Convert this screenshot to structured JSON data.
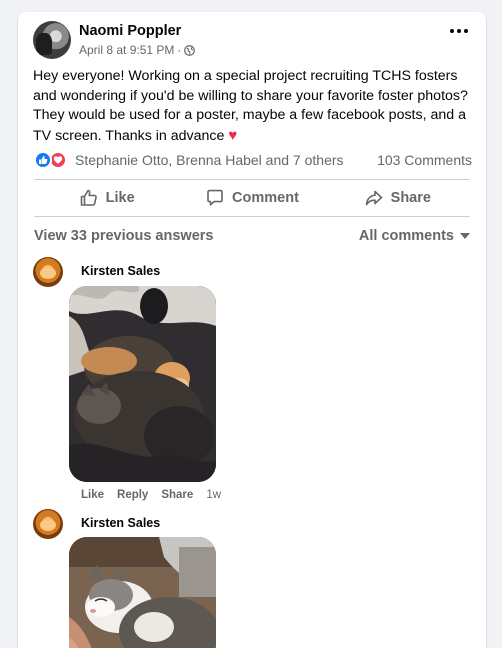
{
  "post": {
    "author": "Naomi Poppler",
    "timestamp": "April 8 at 9:51 PM",
    "separator": "·",
    "body": "Hey everyone! Working on a special project recruiting TCHS fosters and wondering if you'd be willing to share your favorite foster photos? They would be used for a poster, maybe a few facebook posts, and a TV screen. Thanks in advance",
    "heart": "♥",
    "audience_icon": "globe-icon"
  },
  "reactions": {
    "summary": "Stephanie Otto, Brenna Habel and 7 others",
    "comments_count": "103 Comments",
    "icons": [
      "like-reaction-icon",
      "love-reaction-icon"
    ]
  },
  "actions": {
    "like": "Like",
    "comment": "Comment",
    "share": "Share"
  },
  "comments_header": {
    "view_previous": "View 33 previous answers",
    "filter": "All comments"
  },
  "comments": [
    {
      "author": "Kirsten Sales",
      "actions": [
        "Like",
        "Reply",
        "Share"
      ],
      "time": "1w"
    },
    {
      "author": "Kirsten Sales"
    }
  ],
  "colors": {
    "background": "#f0f2f5",
    "card": "#ffffff",
    "secondary_text": "#65676b",
    "like_blue": "#1877f2",
    "love_red": "#f33e58"
  }
}
